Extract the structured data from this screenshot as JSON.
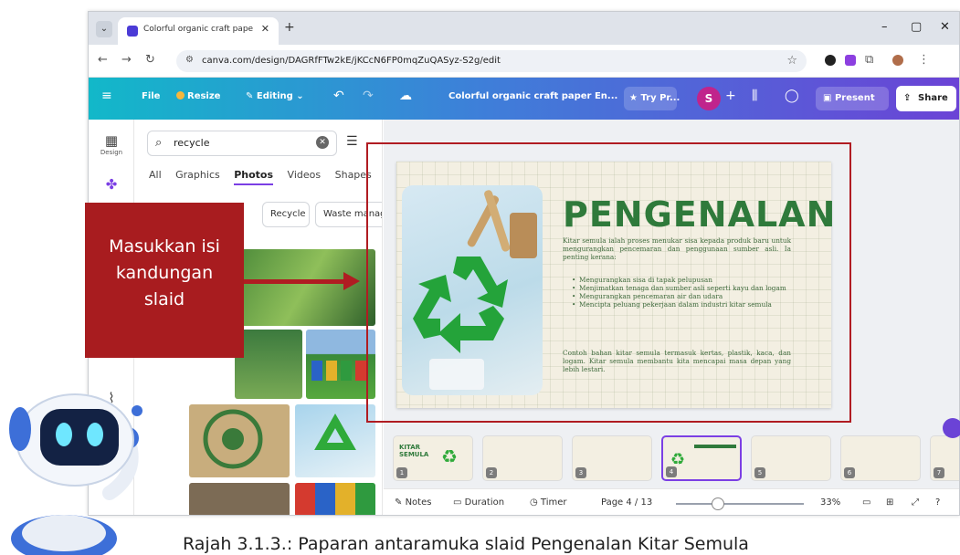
{
  "browser": {
    "tab_title": "Colorful organic craft paper En",
    "tab_close": "✕",
    "new_tab": "+",
    "url": "canva.com/design/DAGRfFTw2kE/jKCcN6FP0mqZuQASyz-S2g/edit",
    "window_controls": {
      "minimize": "–",
      "maximize": "▢",
      "close": "✕"
    }
  },
  "canva": {
    "menu": "≡",
    "file": "File",
    "resize": "Resize",
    "editing": "Editing",
    "undo": "↶",
    "redo": "↷",
    "design_title": "Colorful organic craft paper En...",
    "try_pro": "Try Pr...",
    "avatar_initial": "S",
    "add_people": "+",
    "present": "Present",
    "share": "Share"
  },
  "rail": {
    "design": "Design",
    "elements": "Elements",
    "uploads": "Uploads"
  },
  "panel": {
    "search_value": "recycle",
    "categories": [
      "All",
      "Graphics",
      "Photos",
      "Videos",
      "Shapes"
    ],
    "active_category": "Photos",
    "chips": [
      "Recycle",
      "Waste management"
    ]
  },
  "slide": {
    "title": "PENGENALAN",
    "intro": "Kitar semula ialah proses menukar sisa kepada produk baru untuk mengurangkan pencemaran dan penggunaan sumber asli. Ia penting kerana:",
    "bullets": [
      "Mengurangkan sisa di tapak pelupusan",
      "Menjimatkan tenaga dan sumber asli seperti kayu dan logam",
      "Mengurangkan pencemaran air dan udara",
      "Mencipta peluang pekerjaan dalam industri kitar semula"
    ],
    "outro": "Contoh bahan kitar semula termasuk kertas, plastik, kaca, dan logam. Kitar semula membantu kita mencapai masa depan yang lebih lestari."
  },
  "thumbnails": {
    "first_title": "KITAR SEMULA",
    "numbers": [
      "1",
      "2",
      "3",
      "4",
      "5",
      "6",
      "7"
    ],
    "selected": 4
  },
  "bottombar": {
    "notes": "Notes",
    "duration": "Duration",
    "timer": "Timer",
    "page": "Page 4 / 13",
    "zoom": "33%",
    "zoom_fraction": 0.33
  },
  "callout": {
    "line1": "Masukkan isi",
    "line2": "kandungan",
    "line3": "slaid"
  },
  "caption": "Rajah 3.1.3.: Paparan antaramuka slaid Pengenalan Kitar Semula",
  "colors": {
    "callout_red": "#a81c1f",
    "slide_green": "#2f7a3b",
    "canva_accent": "#7b3fe4"
  }
}
